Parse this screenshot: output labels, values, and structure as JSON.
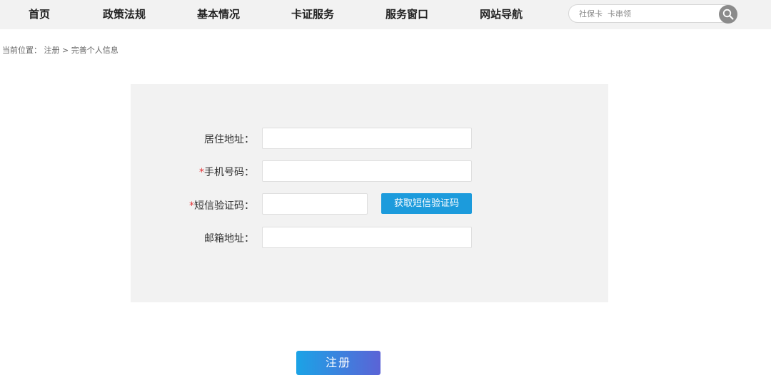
{
  "nav": {
    "items": [
      "首页",
      "政策法规",
      "基本情况",
      "卡证服务",
      "服务窗口",
      "网站导航"
    ]
  },
  "search": {
    "placeholder": "社保卡  卡串领",
    "icon": "search-icon"
  },
  "breadcrumb": {
    "prefix": "当前位置：",
    "parent": "注册",
    "separator": ">",
    "current": "完善个人信息"
  },
  "form": {
    "address_label": "居住地址：",
    "phone_label": "手机号码：",
    "sms_label": "短信验证码：",
    "email_label": "邮箱地址：",
    "required_mark": "*",
    "get_sms_button": "获取短信验证码"
  },
  "submit": {
    "label": "注册"
  },
  "colors": {
    "accent": "#1c9bdc",
    "required": "#e4393c",
    "panel_bg": "#f2f2f2"
  }
}
